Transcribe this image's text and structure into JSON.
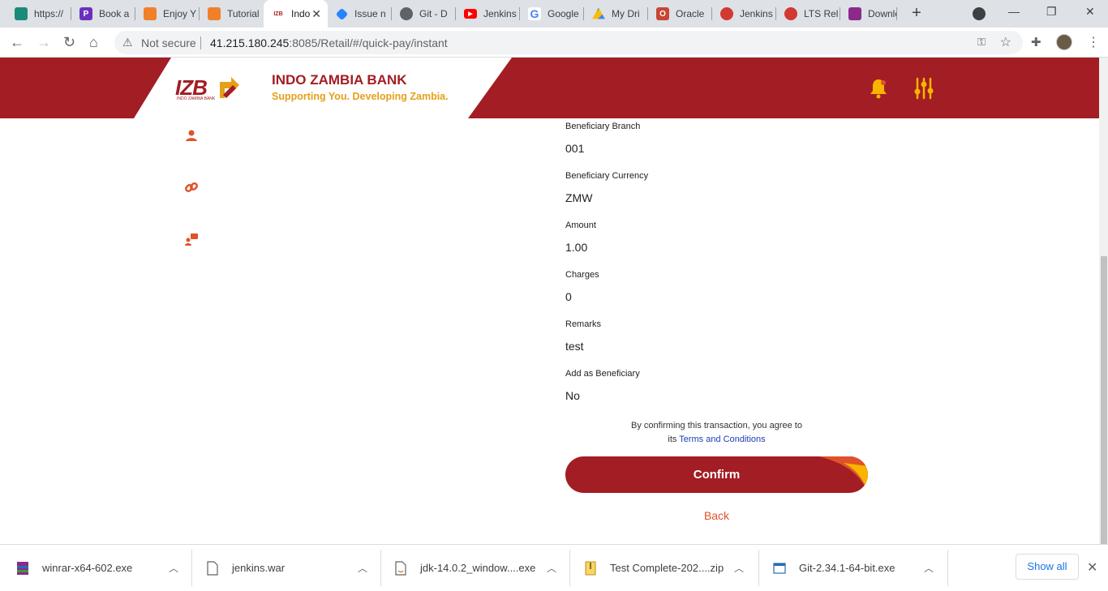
{
  "browser": {
    "tabs": [
      {
        "label": "https://",
        "favicon": "leaf-icon",
        "color": "#1a8a7a"
      },
      {
        "label": "Book a",
        "favicon": "p-icon",
        "color": "#6b2fbf"
      },
      {
        "label": "Enjoy Y",
        "favicon": "orange-logo-icon",
        "color": "#f0802a"
      },
      {
        "label": "Tutorial",
        "favicon": "orange-logo-icon",
        "color": "#f0802a"
      },
      {
        "label": "Indo",
        "favicon": "izb-icon",
        "color": "#a31d24"
      },
      {
        "label": "Issue n",
        "favicon": "jira-icon",
        "color": "#2684ff"
      },
      {
        "label": "Git - D",
        "favicon": "globe-icon",
        "color": "#5f6368"
      },
      {
        "label": "Jenkins",
        "favicon": "youtube-icon",
        "color": "#ff0000"
      },
      {
        "label": "Google",
        "favicon": "google-icon",
        "color": "#4285f4"
      },
      {
        "label": "My Dri",
        "favicon": "drive-icon",
        "color": "#fbbc04"
      },
      {
        "label": "Oracle",
        "favicon": "oracle-icon",
        "color": "#c74634"
      },
      {
        "label": "Jenkins",
        "favicon": "jenkins-icon",
        "color": "#d33833"
      },
      {
        "label": "LTS Rel",
        "favicon": "jenkins-icon",
        "color": "#d33833"
      },
      {
        "label": "Downlo",
        "favicon": "winrar-icon",
        "color": "#8b2a8b"
      }
    ],
    "address": {
      "security": "Not secure",
      "host": "41.215.180.245",
      "path": ":8085/Retail/#/quick-pay/instant"
    }
  },
  "header": {
    "logo_text": "IZB",
    "logo_subtext": "INDO ZAMBIA BANK",
    "bank_name": "INDO ZAMBIA BANK",
    "tagline": "Supporting You. Developing Zambia."
  },
  "fields": [
    {
      "label": "Beneficiary Branch",
      "value": "001"
    },
    {
      "label": "Beneficiary Currency",
      "value": "ZMW"
    },
    {
      "label": "Amount",
      "value": "1.00"
    },
    {
      "label": "Charges",
      "value": "0"
    },
    {
      "label": "Remarks",
      "value": "test"
    },
    {
      "label": "Add as Beneficiary",
      "value": "No"
    }
  ],
  "terms": {
    "line1": "By confirming this transaction, you agree to",
    "prefix": "its",
    "link": "Terms and Conditions"
  },
  "actions": {
    "confirm": "Confirm",
    "back": "Back"
  },
  "downloads": {
    "items": [
      {
        "name": "winrar-x64-602.exe"
      },
      {
        "name": "jenkins.war"
      },
      {
        "name": "jdk-14.0.2_window....exe"
      },
      {
        "name": "Test Complete-202....zip"
      },
      {
        "name": "Git-2.34.1-64-bit.exe"
      }
    ],
    "show_all": "Show all"
  },
  "colors": {
    "brand": "#a31d24",
    "accent": "#e5a019",
    "link": "#1a3fb5",
    "back": "#e0522a"
  }
}
